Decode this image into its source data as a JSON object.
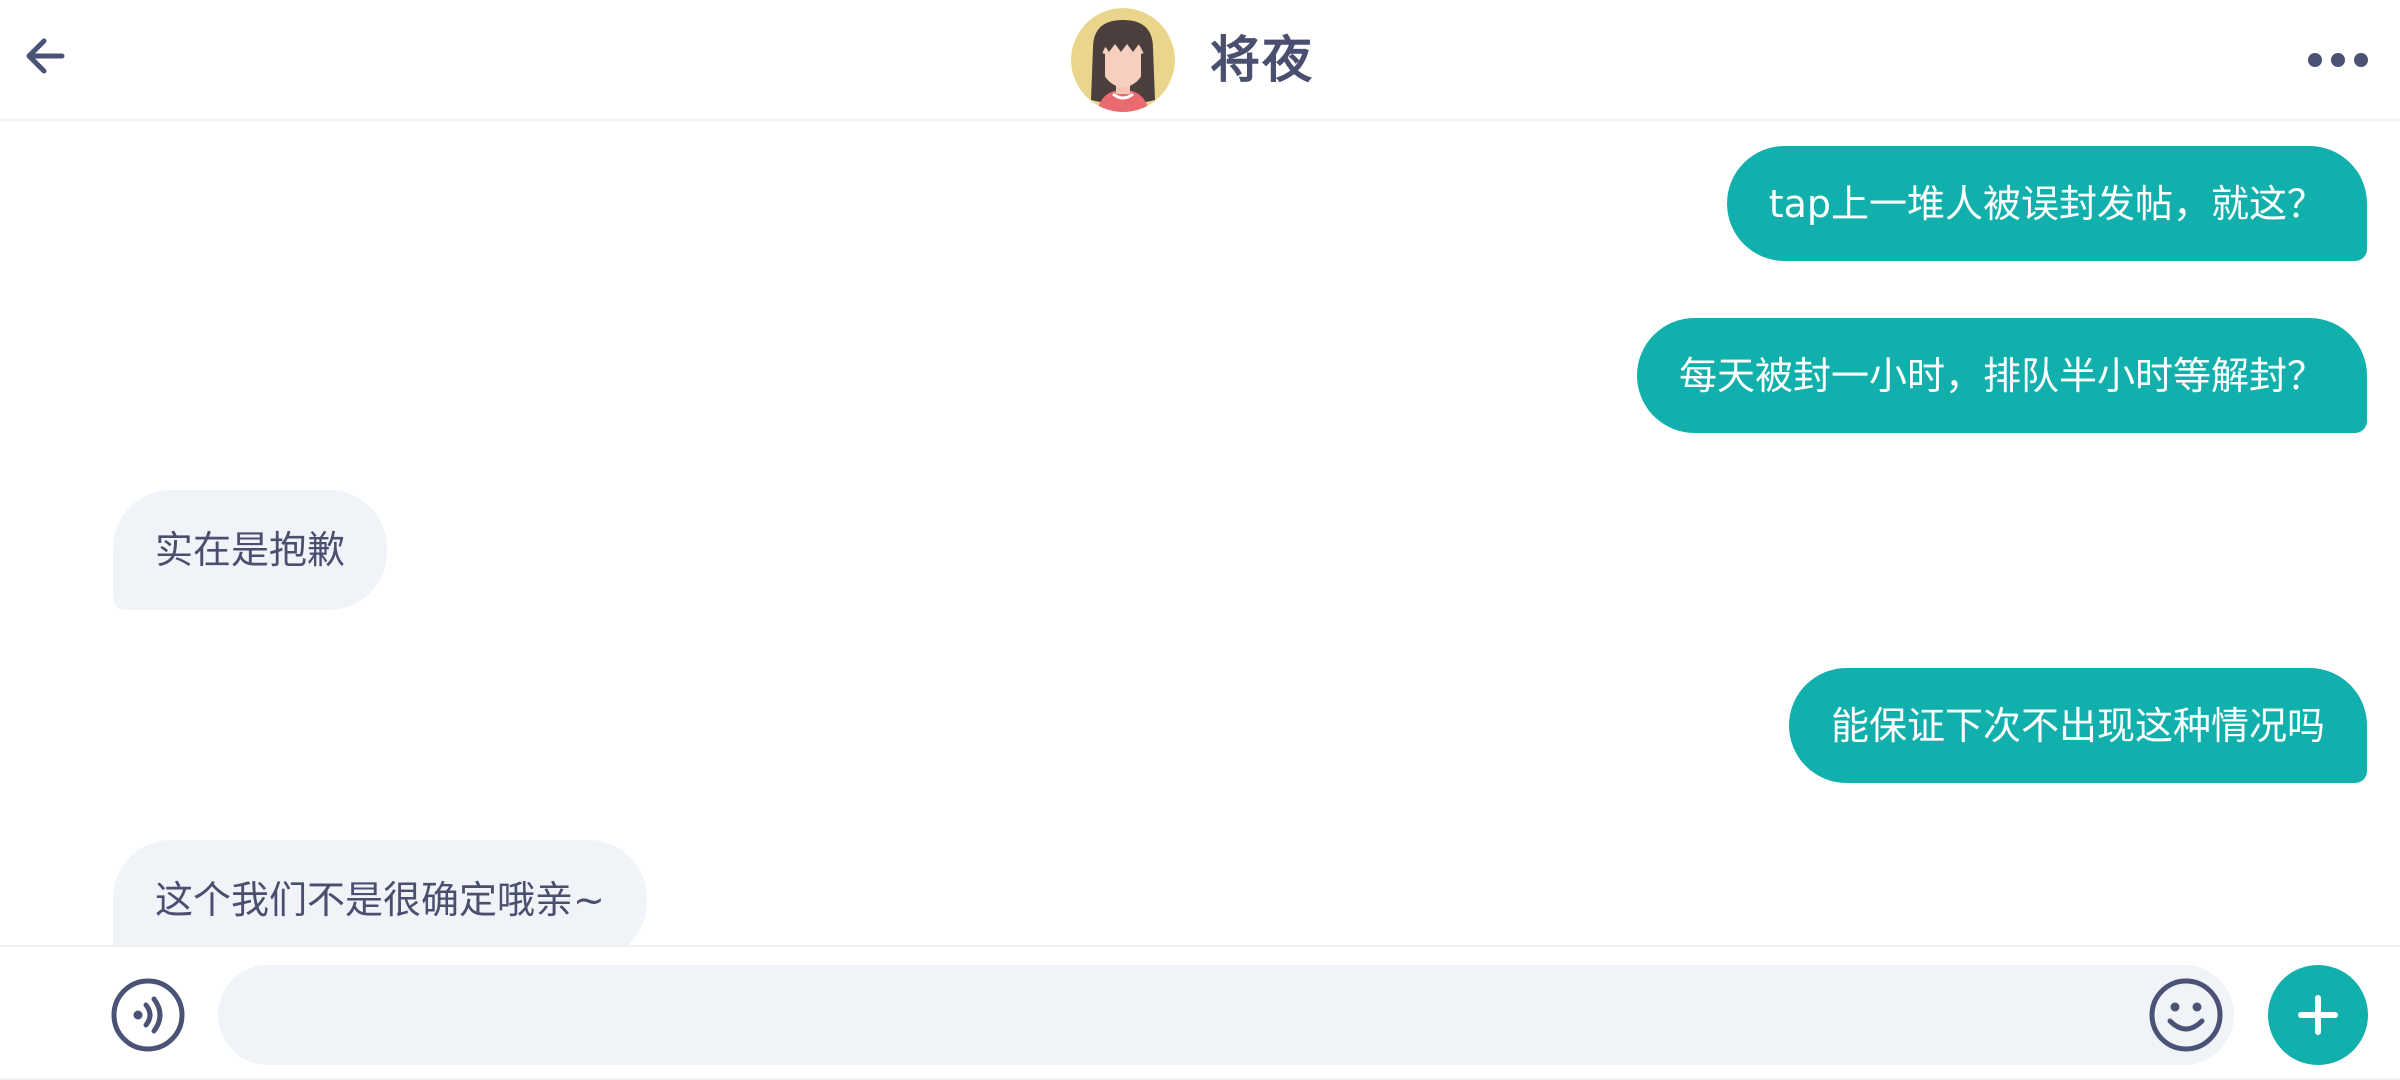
{
  "header": {
    "title": "将夜",
    "back_icon": "arrow-left-icon",
    "more_icon": "more-horizontal-icon",
    "avatar": "avatar-girl-illustration"
  },
  "messages": [
    {
      "direction": "outgoing",
      "text": "tap上一堆人被误封发帖，就这？"
    },
    {
      "direction": "outgoing",
      "text": "每天被封一小时，排队半小时等解封？"
    },
    {
      "direction": "incoming",
      "text": "实在是抱歉"
    },
    {
      "direction": "outgoing",
      "text": "能保证下次不出现这种情况吗"
    },
    {
      "direction": "incoming",
      "text": "这个我们不是很确定哦亲~"
    }
  ],
  "input_bar": {
    "voice_icon": "voice-icon",
    "input_value": "",
    "input_placeholder": "",
    "emoji_icon": "emoji-icon",
    "plus_icon": "plus-icon"
  },
  "colors": {
    "accent": "#12b0ac",
    "incoming_bubble": "#f0f3f7",
    "text_dark": "#4a4f6f",
    "icon": "#4a5275"
  }
}
